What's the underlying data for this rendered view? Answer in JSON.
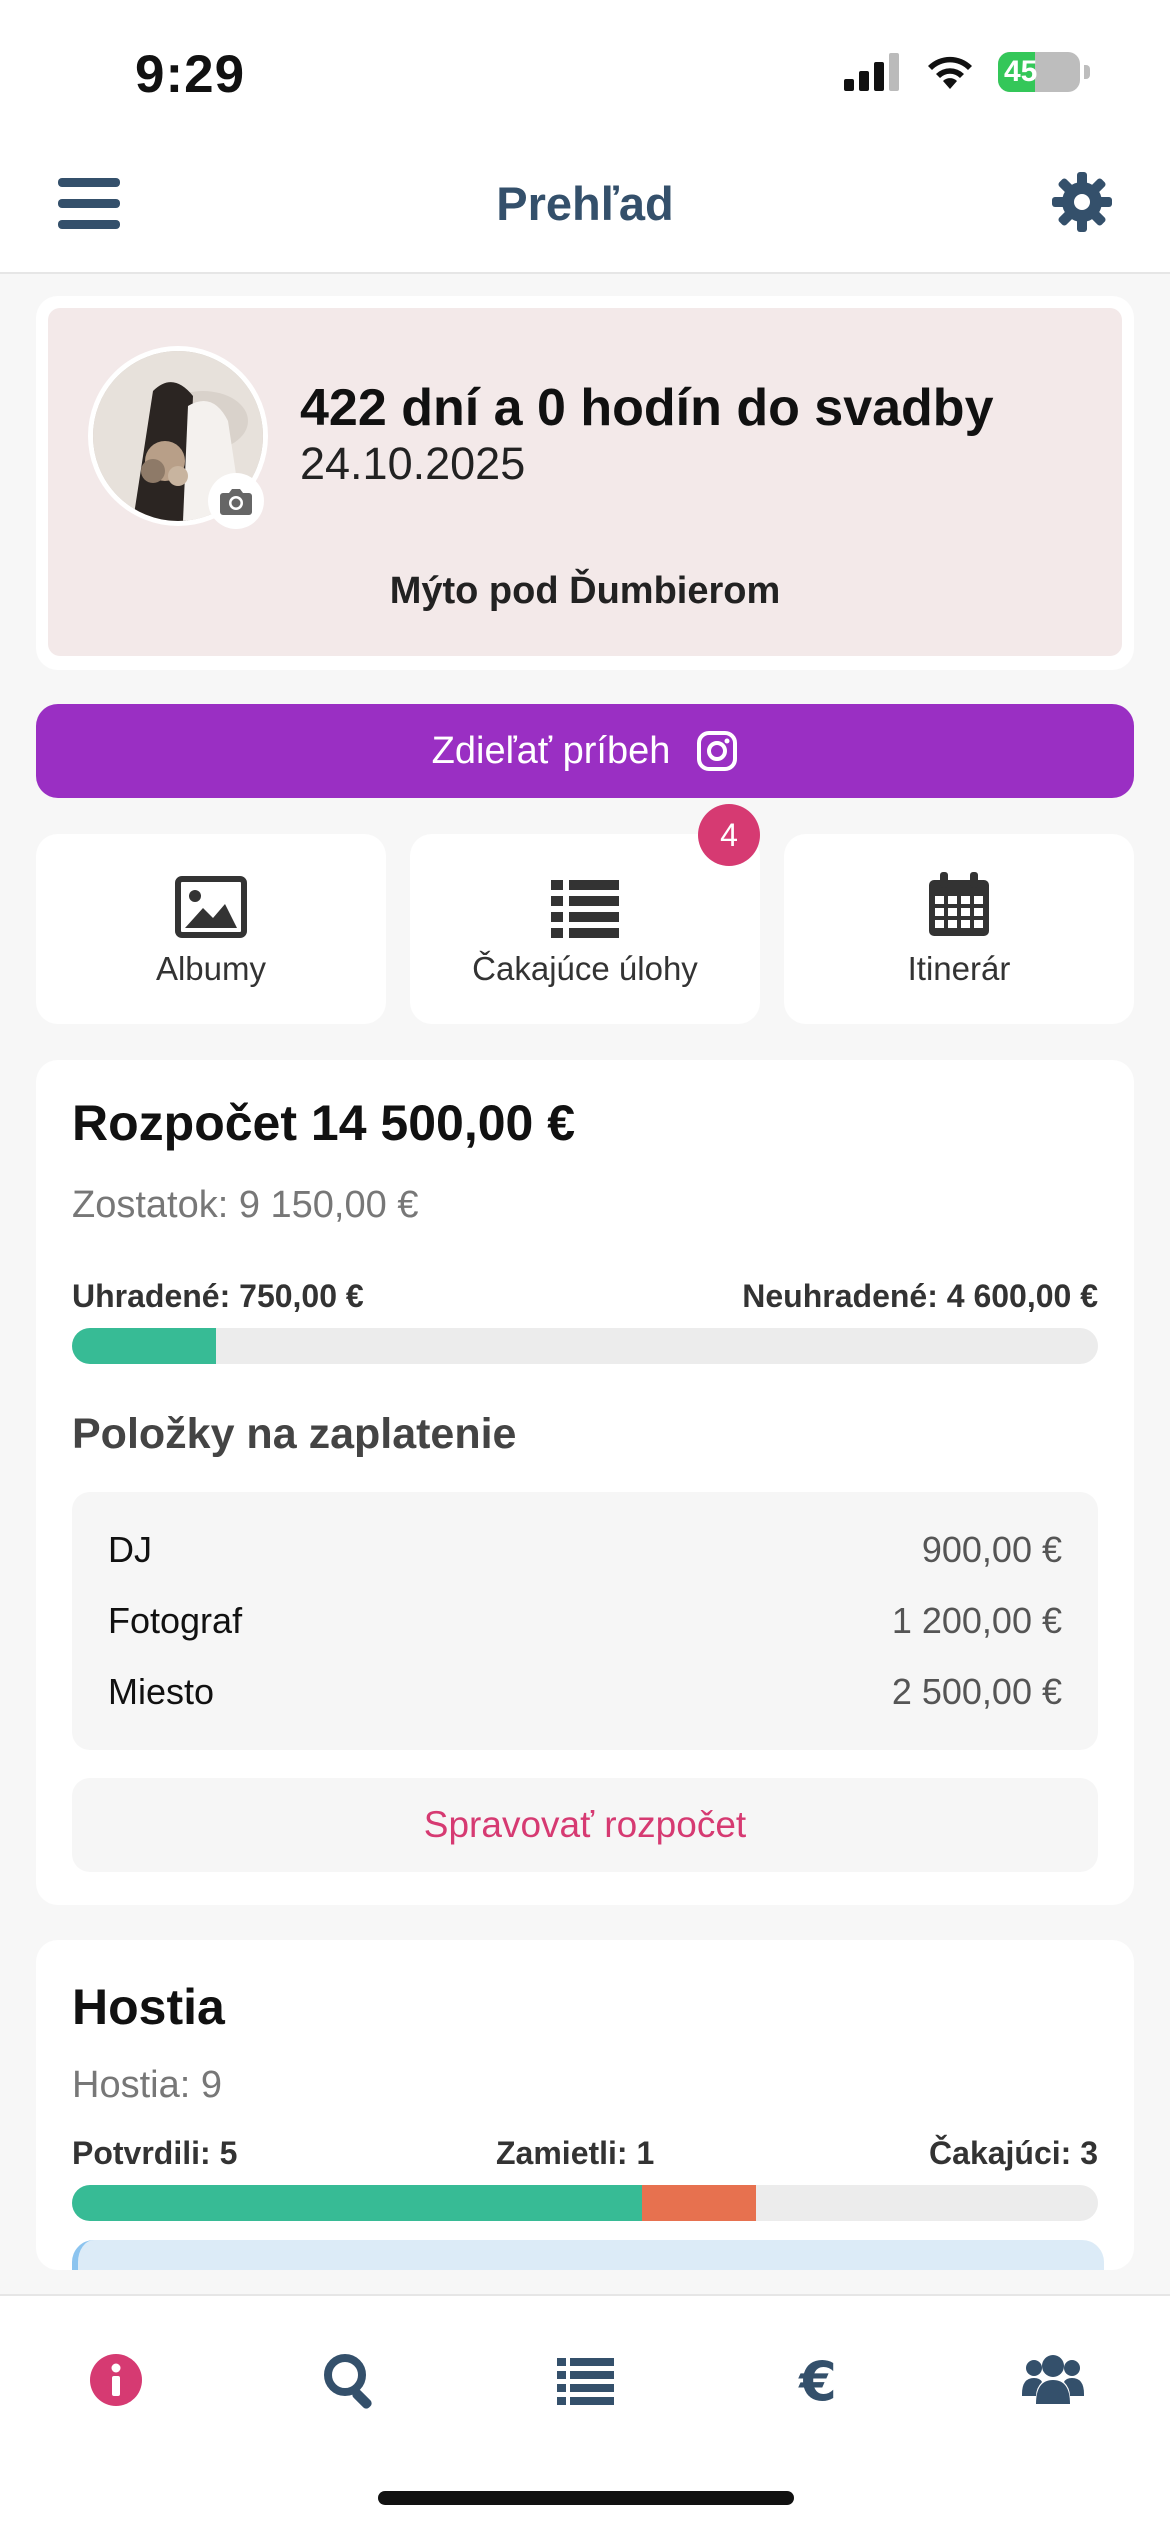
{
  "status_bar": {
    "time": "9:29",
    "battery": "45"
  },
  "header": {
    "title": "Prehľad",
    "menu_icon": "hamburger-menu-icon",
    "settings_icon": "gear-icon"
  },
  "hero": {
    "countdown": "422 dní a 0 hodín do svadby",
    "date": "24.10.2025",
    "venue": "Mýto pod Ďumbierom"
  },
  "share_button": {
    "label": "Zdieľať príbeh",
    "icon": "instagram-icon",
    "color": "#9a2fc3"
  },
  "quick_tiles": [
    {
      "label": "Albumy",
      "icon": "image-icon"
    },
    {
      "label": "Čakajúce úlohy",
      "icon": "list-icon",
      "badge": "4"
    },
    {
      "label": "Itinerár",
      "icon": "calendar-icon"
    }
  ],
  "budget": {
    "title": "Rozpočet 14 500,00 €",
    "remaining": "Zostatok: 9 150,00 €",
    "paid_label": "Uhradené: 750,00 €",
    "unpaid_label": "Neuhradené: 4 600,00 €",
    "paid_fraction": 0.14,
    "section_title": "Položky na zaplatenie",
    "items": [
      {
        "name": "DJ",
        "amount": "900,00 €"
      },
      {
        "name": "Fotograf",
        "amount": "1 200,00 €"
      },
      {
        "name": "Miesto",
        "amount": "2 500,00 €"
      }
    ],
    "manage_button": "Spravovať rozpočet"
  },
  "guests": {
    "title": "Hostia",
    "total": "Hostia: 9",
    "confirmed_label": "Potvrdili: 5",
    "declined_label": "Zamietli: 1",
    "pending_label": "Čakajúci: 3",
    "confirmed_fraction": 0.556,
    "declined_fraction": 0.111
  },
  "tab_bar": [
    {
      "icon": "info-icon",
      "active": true
    },
    {
      "icon": "search-icon",
      "active": false
    },
    {
      "icon": "list-icon",
      "active": false
    },
    {
      "icon": "euro-icon",
      "active": false
    },
    {
      "icon": "users-icon",
      "active": false
    }
  ],
  "colors": {
    "accent": "#d63a72",
    "nav_text": "#34506b",
    "paid": "#37bb95",
    "declined": "#e7714f"
  }
}
